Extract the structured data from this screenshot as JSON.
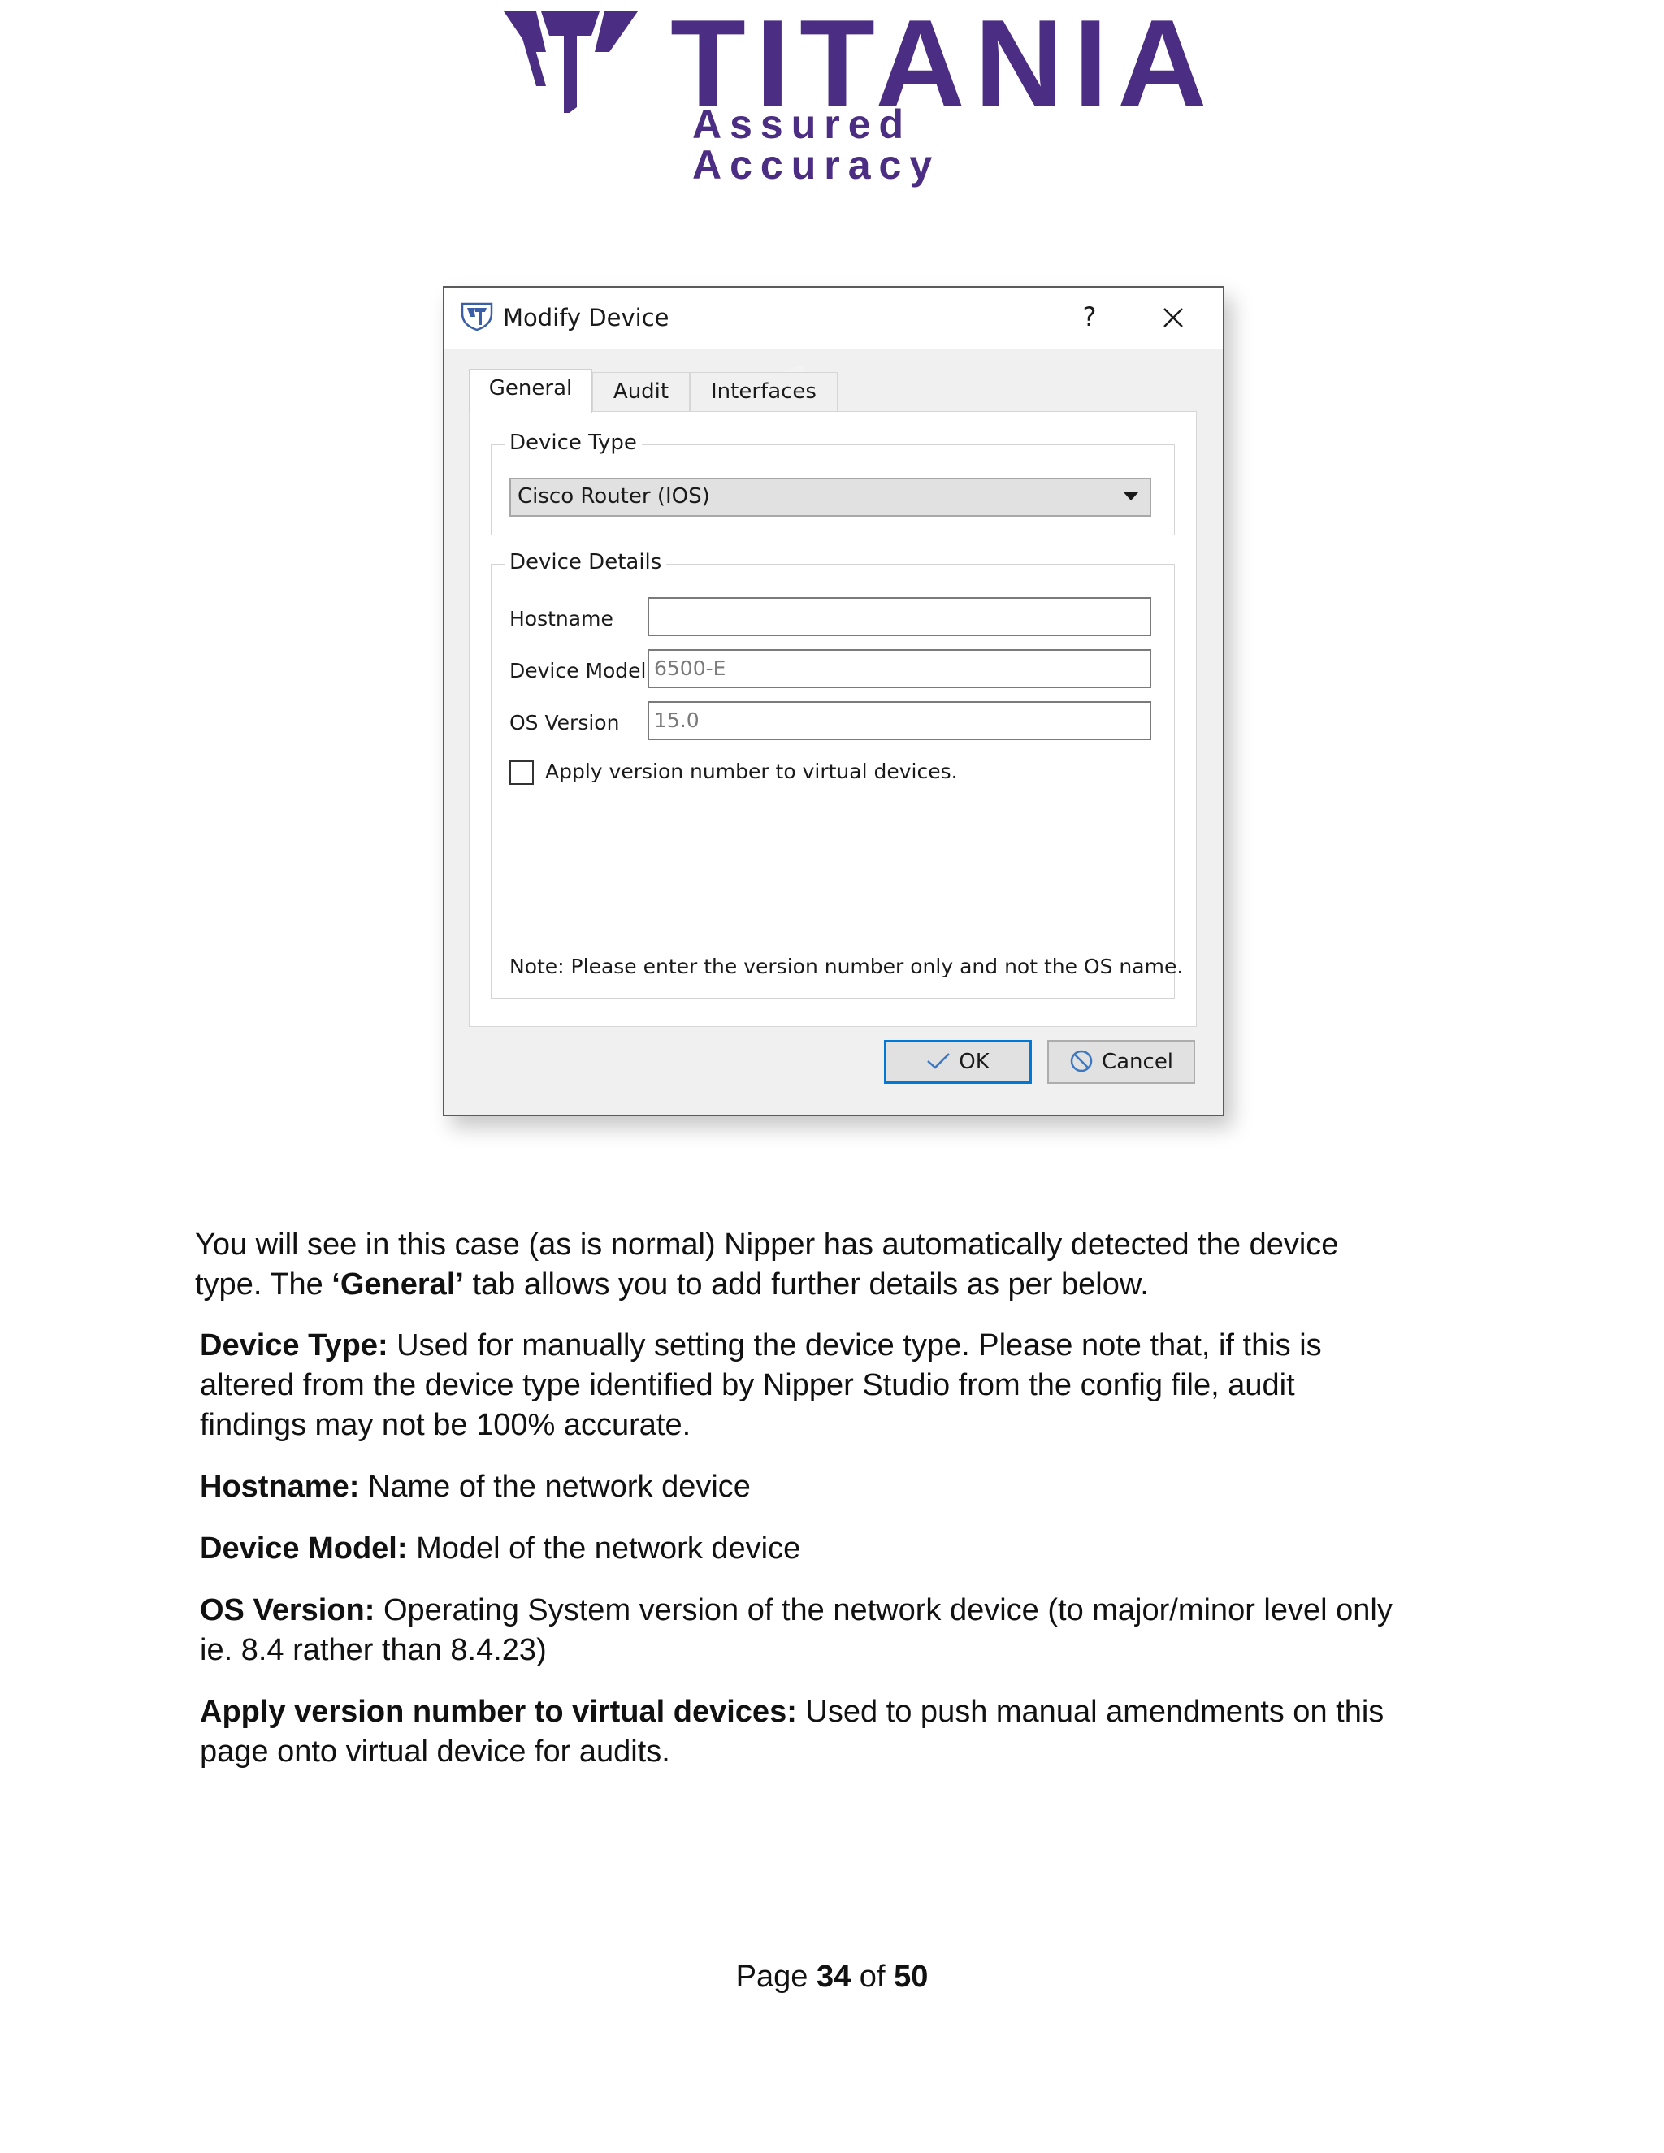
{
  "header": {
    "brand_name": "TITANIA",
    "tagline": "Assured Accuracy",
    "brand_color": "#4b2d83"
  },
  "dialog": {
    "title": "Modify Device",
    "help_label": "?",
    "tabs": [
      {
        "label": "General",
        "active": true
      },
      {
        "label": "Audit",
        "active": false
      },
      {
        "label": "Interfaces",
        "active": false
      }
    ],
    "device_type": {
      "legend": "Device Type",
      "selected": "Cisco Router (IOS)"
    },
    "device_details": {
      "legend": "Device Details",
      "hostname": {
        "label": "Hostname",
        "value": ""
      },
      "device_model": {
        "label": "Device Model",
        "value": "6500-E"
      },
      "os_version": {
        "label": "OS Version",
        "value": "15.0"
      },
      "apply_checkbox": {
        "label": "Apply version number to virtual devices.",
        "checked": false
      }
    },
    "note": "Note: Please enter the version number only and not the OS name.",
    "buttons": {
      "ok": "OK",
      "cancel": "Cancel"
    },
    "accent_color": "#0078d7"
  },
  "content": {
    "intro_1": "You will see in this case (as is normal) Nipper has automatically detected the device",
    "intro_2a": "type. The ",
    "intro_2b": "‘General’",
    "intro_2c": " tab allows you to add further details as per below.",
    "items": [
      {
        "term": "Device Type:",
        "lines": [
          " Used for manually setting the device type. Please note that, if this is",
          "altered from the device type identified by Nipper Studio from the config file, audit",
          "findings may not be 100% accurate."
        ]
      },
      {
        "term": "Hostname:",
        "lines": [
          " Name of the network device"
        ]
      },
      {
        "term": "Device Model:",
        "lines": [
          " Model of the network device"
        ]
      },
      {
        "term": "OS Version:",
        "lines": [
          " Operating System version of the network device (to major/minor level only",
          "ie. 8.4 rather than 8.4.23)"
        ]
      },
      {
        "term": "Apply version number to virtual devices:",
        "lines": [
          " Used to push manual amendments on this",
          "page onto virtual device for audits."
        ]
      }
    ]
  },
  "footer": {
    "prefix": "Page ",
    "current": "34",
    "middle": " of ",
    "total": "50"
  }
}
